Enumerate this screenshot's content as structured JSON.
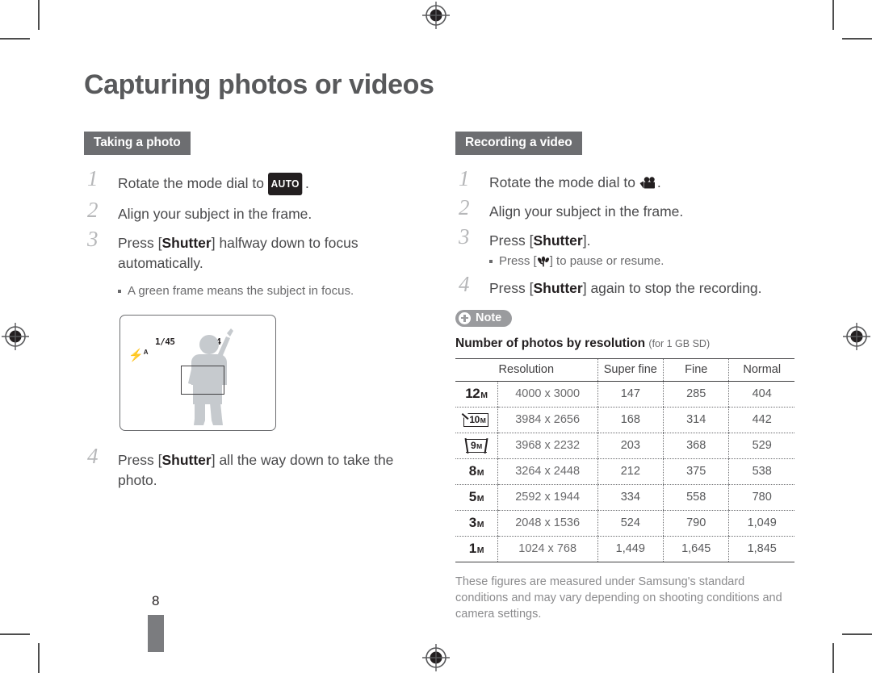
{
  "page": {
    "title": "Capturing photos or videos",
    "number": "8"
  },
  "left_column": {
    "section_tag": "Taking a photo",
    "steps": [
      {
        "num": "1",
        "prefix": "Rotate the mode dial to ",
        "badge": "AUTO",
        "suffix": "."
      },
      {
        "num": "2",
        "text": "Align your subject in the frame."
      },
      {
        "num": "3",
        "prefix": "Press [",
        "bold": "Shutter",
        "suffix": "] halfway down to focus automatically."
      },
      {
        "num": "4",
        "prefix": "Press [",
        "bold": "Shutter",
        "suffix": "] all the way down to take the photo."
      }
    ],
    "substep": "A green frame means the subject in focus.",
    "lcd": {
      "shutter_speed": "1/45",
      "aperture": "F8.4",
      "flash_mode": "A",
      "flash_icon": "flash-auto-icon",
      "subject_icon": "person-silhouette",
      "focus_frame": "focus-frame"
    }
  },
  "right_column": {
    "section_tag": "Recording a video",
    "steps": [
      {
        "num": "1",
        "prefix": "Rotate the mode dial to ",
        "icon": "movie-camera-icon",
        "suffix": "."
      },
      {
        "num": "2",
        "text": "Align your subject in the frame."
      },
      {
        "num": "3",
        "prefix": "Press [",
        "bold": "Shutter",
        "suffix": "]."
      },
      {
        "num": "4",
        "prefix": "Press [",
        "bold": "Shutter",
        "suffix": "] again to stop the recording."
      }
    ],
    "substep": {
      "prefix": "Press [",
      "icon": "macro-flower-icon",
      "suffix": "] to pause or resume."
    },
    "note": {
      "badge_label": "Note",
      "badge_icon": "plus-circle-icon",
      "heading": "Number of photos by resolution",
      "heading_sub": "(for 1 GB SD)",
      "footnote": "These figures are measured under Samsung's standard conditions and may vary depending on shooting conditions and camera settings."
    },
    "table": {
      "headers": [
        "Resolution",
        "Super fine",
        "Fine",
        "Normal"
      ],
      "rows": [
        {
          "badge": "12",
          "badge_style": "plain",
          "resolution": "4000 x 3000",
          "super_fine": "147",
          "fine": "285",
          "normal": "404"
        },
        {
          "badge": "10",
          "badge_style": "cut",
          "resolution": "3984 x 2656",
          "super_fine": "168",
          "fine": "314",
          "normal": "442"
        },
        {
          "badge": "9",
          "badge_style": "pano",
          "resolution": "3968 x 2232",
          "super_fine": "203",
          "fine": "368",
          "normal": "529"
        },
        {
          "badge": "8",
          "badge_style": "plain",
          "resolution": "3264 x 2448",
          "super_fine": "212",
          "fine": "375",
          "normal": "538"
        },
        {
          "badge": "5",
          "badge_style": "plain",
          "resolution": "2592 x 1944",
          "super_fine": "334",
          "fine": "558",
          "normal": "780"
        },
        {
          "badge": "3",
          "badge_style": "plain",
          "resolution": "2048 x 1536",
          "super_fine": "524",
          "fine": "790",
          "normal": "1,049"
        },
        {
          "badge": "1",
          "badge_style": "plain",
          "resolution": "1024 x 768",
          "super_fine": "1,449",
          "fine": "1,645",
          "normal": "1,845"
        }
      ],
      "badge_unit": "M"
    }
  },
  "colors": {
    "title": "#58595b",
    "section_tag_bg": "#6d6e71",
    "note_badge_bg": "#9a9b9e",
    "body_text": "#4a4a4c",
    "muted_text": "#8b8b8d",
    "ink": "#231f20"
  }
}
